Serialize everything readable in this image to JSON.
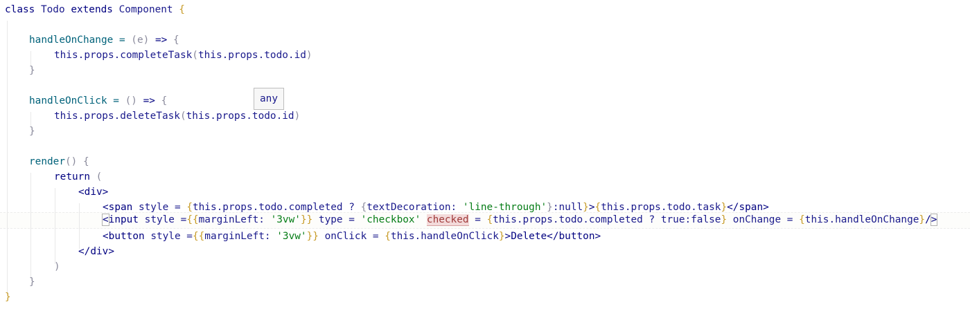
{
  "editor": {
    "lines": {
      "l1": {
        "a": "class ",
        "b": "Todo ",
        "c": "extends ",
        "d": "Component ",
        "e": "{"
      },
      "l3": {
        "a": "handleOnChange = ",
        "b": "(",
        "c": "e",
        "d": ")",
        "e": " => ",
        "f": "{"
      },
      "l4": {
        "a": "this.props.completeTask",
        "b": "(",
        "c": "this.props.todo.id",
        "d": ")"
      },
      "l5": {
        "a": "}"
      },
      "l7": {
        "a": "handleOnClick = ",
        "b": "()",
        "c": " => ",
        "d": "{"
      },
      "l8": {
        "a": "this.props.deleteTask",
        "b": "(",
        "c": "this.props.todo.id",
        "d": ")"
      },
      "l9": {
        "a": "}"
      },
      "l11": {
        "a": "render",
        "b": "()",
        "c": " {"
      },
      "l12": {
        "a": "return ",
        "b": "("
      },
      "l13": {
        "a": "<div>"
      },
      "l14": {
        "a": "<span ",
        "b": "style",
        "c": " = ",
        "d": "{",
        "e": "this.props.todo.completed ? ",
        "f": "{",
        "g": "textDecoration: ",
        "h": "'line-through'",
        "i": "}",
        "j": ":null",
        "k": "}",
        "l": ">",
        "m": "{",
        "n": "this.props.todo.task",
        "o": "}",
        "p": "</span>"
      },
      "l15": {
        "a": "<",
        "b": "input ",
        "c": "style",
        "d": " =",
        "e": "{{",
        "f": "marginLeft: ",
        "g": "'3vw'",
        "h": "}}",
        "i": " type",
        "j": " = ",
        "k": "'checkbox'",
        "l": " ",
        "m": "checked",
        "n": " = ",
        "o": "{",
        "p": "this.props.todo.completed ? true:false",
        "q": "}",
        "r": " onChange",
        "s": " = ",
        "t": "{",
        "u": "this.handleOnChange",
        "v": "}",
        "w": "/",
        "x": ">"
      },
      "l16": {
        "a": "<button ",
        "b": "style",
        "c": " =",
        "d": "{{",
        "e": "marginLeft: ",
        "f": "'3vw'",
        "g": "}}",
        "h": " onClick",
        "i": " = ",
        "j": "{",
        "k": "this.handleOnClick",
        "l": "}",
        "m": ">Delete</button>"
      },
      "l17": {
        "a": "</div>"
      },
      "l18": {
        "a": ")"
      },
      "l19": {
        "a": "}"
      },
      "l20": {
        "a": "}"
      }
    },
    "tooltip": "any"
  },
  "colors": {
    "keyword": "#000080",
    "string": "#067d17",
    "brace": "#c79b27",
    "highlight": "#f3dada"
  }
}
